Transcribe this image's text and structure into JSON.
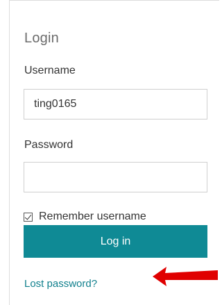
{
  "login": {
    "title": "Login",
    "username_label": "Username",
    "username_value": "ting0165",
    "password_label": "Password",
    "password_value": "",
    "remember_label": "Remember username",
    "remember_checked": true,
    "login_button": "Log in",
    "lost_password_link": "Lost password?"
  },
  "colors": {
    "accent": "#0f8a95",
    "link": "#0f7f8c",
    "arrow": "#e00000"
  },
  "icons": {
    "annotation_arrow": "left-arrow-icon"
  }
}
